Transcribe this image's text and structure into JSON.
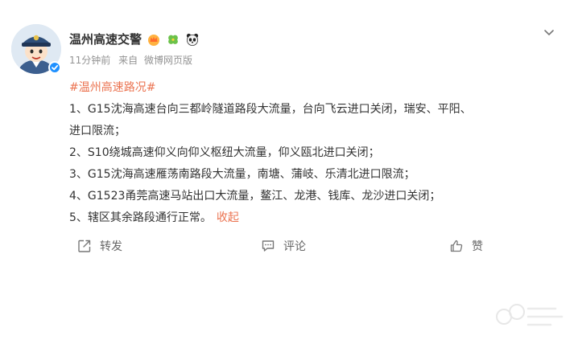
{
  "post": {
    "author": "温州高速交警",
    "time": "11分钟前",
    "source_prefix": "来自",
    "source": "微博网页版",
    "hashtag": "#温州高速路况#",
    "lines": [
      "1、G15沈海高速台向三都岭隧道路段大流量，台向飞云进口关闭，瑞安、平阳、",
      "进口限流；",
      "2、S10绕城高速仰义向仰义枢纽大流量，仰义瓯北进口关闭；",
      "3、G15沈海高速雁荡南路段大流量，南塘、蒲岐、乐清北进口限流；",
      "4、G1523甬莞高速马站出口大流量，鳌江、龙港、钱库、龙沙进口关闭；",
      "5、辖区其余路段通行正常。"
    ],
    "collapse_label": "收起"
  },
  "actions": {
    "repost_label": "转发",
    "comment_label": "评论",
    "like_label": "赞"
  },
  "icons": {
    "avatar": "police-avatar-icon",
    "verified": "verified-badge-icon",
    "badge1": "crown-badge-icon",
    "badge2": "clover-badge-icon",
    "badge3": "panda-badge-icon",
    "more": "chevron-down-icon"
  },
  "colors": {
    "accent": "#eb7350",
    "verified": "#1e90ff",
    "meta": "#939393"
  }
}
